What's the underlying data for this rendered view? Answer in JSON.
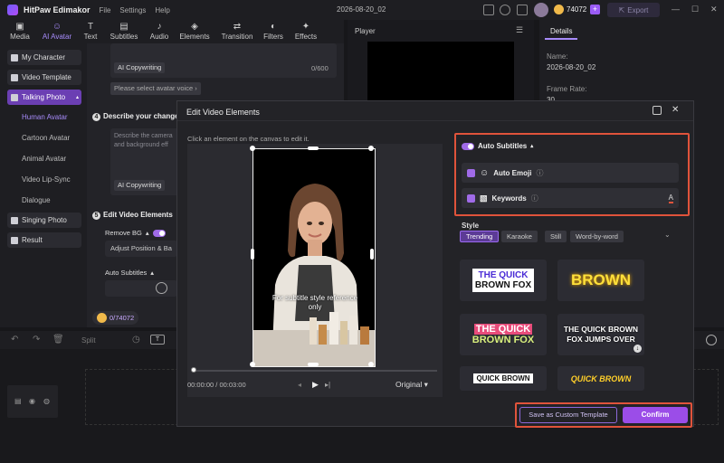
{
  "app": {
    "name": "HitPaw Edimakor",
    "menus": [
      "File",
      "Settings",
      "Help"
    ],
    "doc_title": "2026-08-20_02",
    "credits": "74072",
    "export_label": "Export"
  },
  "tabs": [
    {
      "label": "Media",
      "icon": "media-icon"
    },
    {
      "label": "AI Avatar",
      "icon": "ai-avatar-icon"
    },
    {
      "label": "Text",
      "icon": "text-icon"
    },
    {
      "label": "Subtitles",
      "icon": "subtitles-icon"
    },
    {
      "label": "Audio",
      "icon": "audio-icon"
    },
    {
      "label": "Elements",
      "icon": "elements-icon"
    },
    {
      "label": "Transition",
      "icon": "transition-icon"
    },
    {
      "label": "Filters",
      "icon": "filters-icon"
    },
    {
      "label": "Effects",
      "icon": "effects-icon"
    }
  ],
  "sidebar": {
    "items": [
      "My Character",
      "Video Template",
      "Talking Photo"
    ],
    "sub_items": [
      "Human Avatar",
      "Cartoon Avatar",
      "Animal Avatar",
      "Video Lip-Sync",
      "Dialogue"
    ],
    "bottom_items": [
      "Singing Photo",
      "Result"
    ]
  },
  "middle": {
    "ai_copywriting": "AI Copywriting",
    "char_count": "0/600",
    "voice_placeholder": "Please select avatar voice",
    "step4_title": "Describe your change",
    "step4_placeholder": "Describe the camera and background eff",
    "step5_title": "Edit Video Elements",
    "remove_bg": "Remove BG",
    "adjust_position": "Adjust Position & Ba",
    "auto_subtitles": "Auto Subtitles",
    "credits_cost": "0/74072"
  },
  "player": {
    "title": "Player"
  },
  "details": {
    "tab": "Details",
    "name_label": "Name:",
    "name_value": "2026-08-20_02",
    "frame_rate_label": "Frame Rate:",
    "frame_rate_value": "30"
  },
  "modal": {
    "title": "Edit Video Elements",
    "hint": "Click an element on the canvas to edit it.",
    "subtitle_preview": "For subtitle style reference only",
    "time": "00:00:00 / 00:03:00",
    "aspect": "Original",
    "auto_subtitles": "Auto Subtitles",
    "auto_emoji": "Auto Emoji",
    "keywords": "Keywords",
    "style_label": "Style",
    "style_tabs": [
      "Trending",
      "Karaoke",
      "Still",
      "Word-by-word"
    ],
    "templates": [
      {
        "line1": "THE QUICK",
        "line2": "BROWN FOX"
      },
      {
        "line1": "BROWN",
        "line2": ""
      },
      {
        "line1": "THE QUICK",
        "line2": "BROWN FOX"
      },
      {
        "line1": "THE QUICK BROWN",
        "line2": "FOX JUMPS OVER"
      },
      {
        "line1": "QUICK BROWN",
        "line2": ""
      },
      {
        "line1": "QUICK BROWN",
        "line2": ""
      }
    ],
    "save_custom": "Save as Custom Template",
    "confirm": "Confirm"
  },
  "timeline": {
    "split": "Split"
  },
  "colors": {
    "accent": "#9b4de8",
    "highlight": "#e0533b",
    "background": "#17171a"
  }
}
